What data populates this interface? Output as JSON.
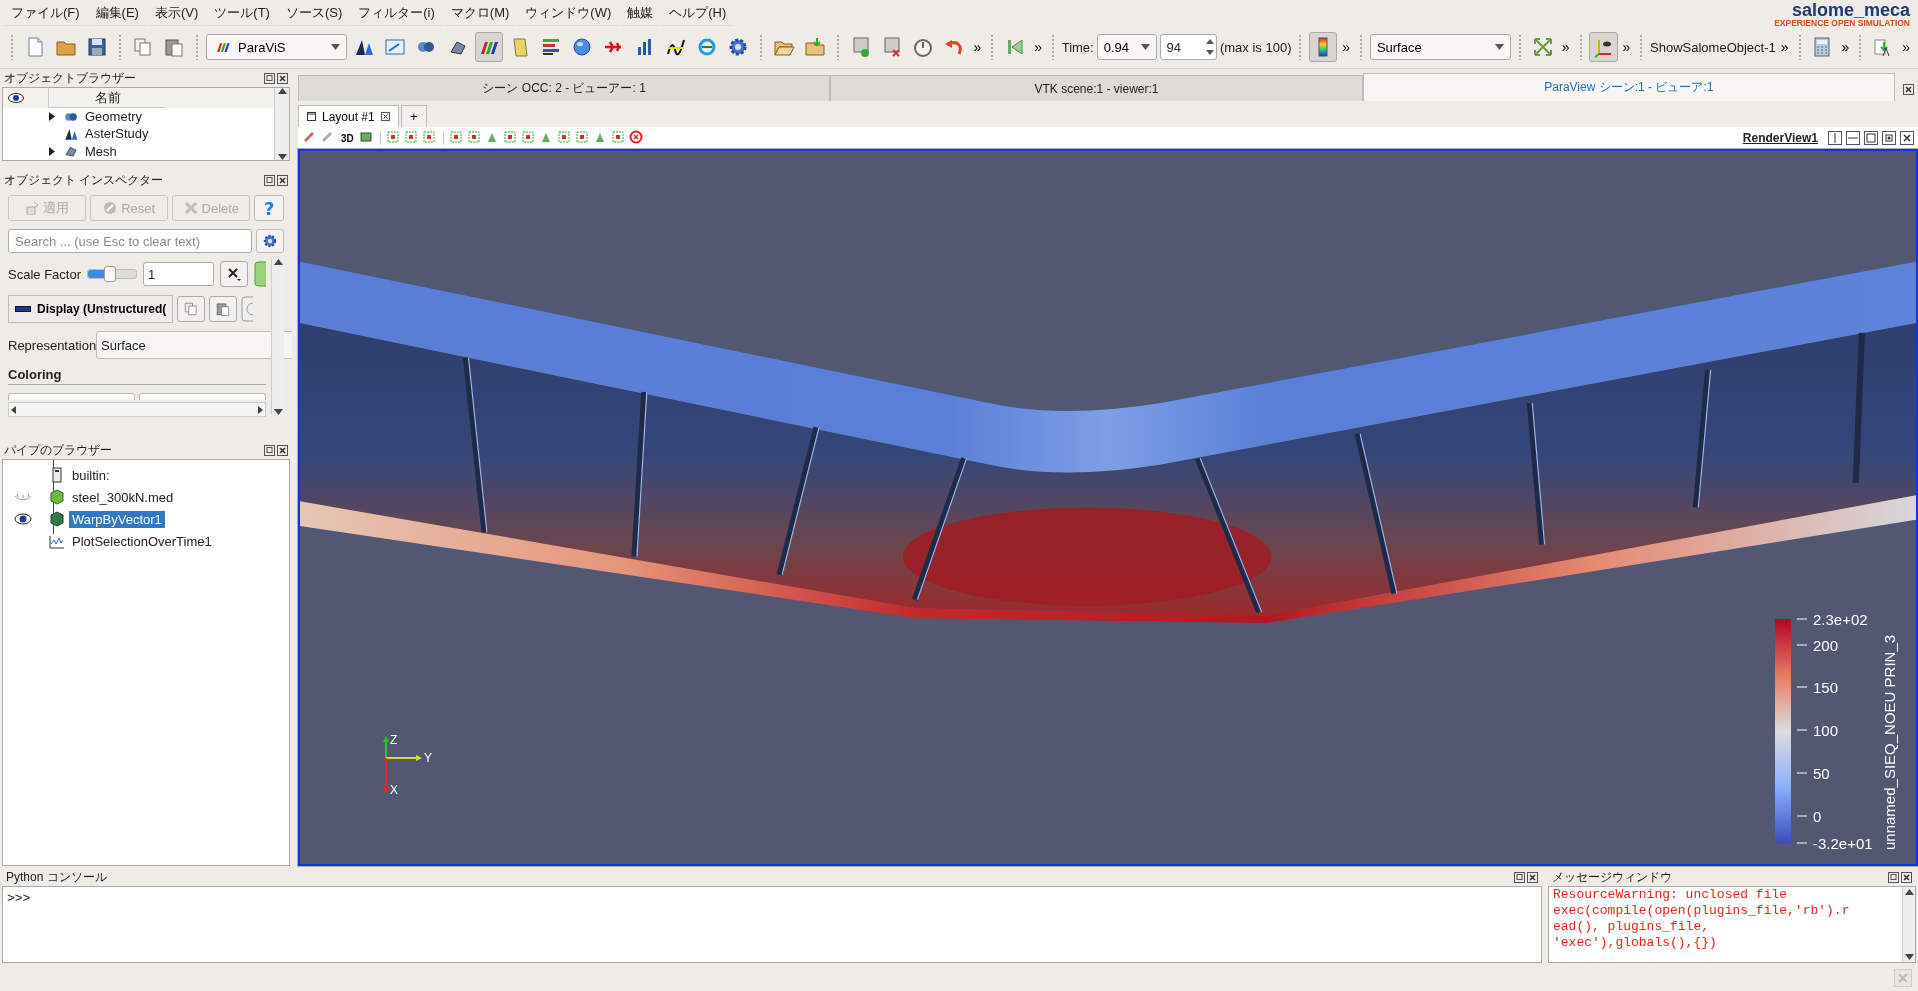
{
  "menu": [
    {
      "label": "ファイル(F)"
    },
    {
      "label": "編集(E)"
    },
    {
      "label": "表示(V)"
    },
    {
      "label": "ツール(T)"
    },
    {
      "label": "ソース(S)"
    },
    {
      "label": "フィルター(i)"
    },
    {
      "label": "マクロ(M)"
    },
    {
      "label": "ウィンドウ(W)"
    },
    {
      "label": "触媒"
    },
    {
      "label": "ヘルプ(H)"
    }
  ],
  "logo": {
    "name": "salome_meca",
    "tagline": "EXPERIENCE OPEN SIMULATION"
  },
  "toolbar": [
    {
      "kind": "sep"
    },
    {
      "kind": "icon",
      "pressed": false
    },
    {
      "kind": "icon",
      "pressed": false
    },
    {
      "kind": "icon",
      "pressed": false
    },
    {
      "kind": "sep"
    },
    {
      "kind": "icon",
      "pressed": false
    },
    {
      "kind": "icon",
      "pressed": false
    },
    {
      "kind": "sep"
    },
    {
      "kind": "combo",
      "value": "ParaViS",
      "icon": true
    },
    {
      "kind": "icon",
      "pressed": false
    },
    {
      "kind": "icon",
      "pressed": false
    },
    {
      "kind": "icon",
      "pressed": false
    },
    {
      "kind": "icon",
      "pressed": false
    },
    {
      "kind": "icon",
      "pressed": true
    },
    {
      "kind": "icon",
      "pressed": false
    },
    {
      "kind": "icon",
      "pressed": false
    },
    {
      "kind": "icon",
      "pressed": false
    },
    {
      "kind": "icon",
      "pressed": false
    },
    {
      "kind": "icon",
      "pressed": false
    },
    {
      "kind": "icon",
      "pressed": false
    },
    {
      "kind": "icon",
      "pressed": false
    },
    {
      "kind": "icon",
      "pressed": false
    },
    {
      "kind": "sep"
    },
    {
      "kind": "icon",
      "pressed": false
    },
    {
      "kind": "icon",
      "pressed": false
    },
    {
      "kind": "sep"
    },
    {
      "kind": "icon",
      "pressed": false
    },
    {
      "kind": "icon",
      "pressed": false
    },
    {
      "kind": "icon",
      "pressed": false
    },
    {
      "kind": "icon",
      "pressed": false
    },
    {
      "kind": "chevron",
      "label": "»"
    },
    {
      "kind": "sep"
    },
    {
      "kind": "icon",
      "pressed": false
    },
    {
      "kind": "chevron",
      "label": "»"
    },
    {
      "kind": "sep"
    },
    {
      "kind": "label",
      "label": "Time:"
    },
    {
      "kind": "combo",
      "value": "0.94"
    },
    {
      "kind": "spin",
      "value": "94"
    },
    {
      "kind": "label",
      "label": "(max is 100)"
    },
    {
      "kind": "sep"
    },
    {
      "kind": "icon",
      "pressed": true
    },
    {
      "kind": "chevron",
      "label": "»"
    },
    {
      "kind": "sep"
    },
    {
      "kind": "combo",
      "value": "Surface"
    },
    {
      "kind": "sep"
    },
    {
      "kind": "icon",
      "pressed": false
    },
    {
      "kind": "chevron",
      "label": "»"
    },
    {
      "kind": "sep"
    },
    {
      "kind": "icon",
      "pressed": true
    },
    {
      "kind": "chevron",
      "label": "»"
    },
    {
      "kind": "sep"
    },
    {
      "kind": "label",
      "label": "ShowSalomeObject-1"
    },
    {
      "kind": "chevron",
      "label": "»"
    },
    {
      "kind": "sep"
    },
    {
      "kind": "icon",
      "pressed": false
    },
    {
      "kind": "chevron",
      "label": "»"
    },
    {
      "kind": "sep"
    },
    {
      "kind": "icon",
      "pressed": false
    },
    {
      "kind": "chevron",
      "label": "»"
    }
  ],
  "object_browser": {
    "title": "オブジェクトブラウザー",
    "column": "名前",
    "items": [
      {
        "label": "Geometry",
        "kind": "branch",
        "expanded": false
      },
      {
        "label": "AsterStudy",
        "kind": "leaf"
      },
      {
        "label": "Mesh",
        "kind": "branch",
        "expanded": false
      }
    ]
  },
  "inspector": {
    "title": "オブジェクト インスペクター",
    "buttons": [
      {
        "label": "適用",
        "disabled": true
      },
      {
        "label": "Reset",
        "disabled": true
      },
      {
        "label": "Delete",
        "disabled": true
      }
    ],
    "help": "?",
    "search": {
      "placeholder": "Search ... (use Esc to clear text)"
    },
    "scale_factor": {
      "label": "Scale Factor",
      "level": 0.45,
      "value": "1"
    },
    "display": "Display (Unstructured(",
    "representation": {
      "label": "Representation",
      "value": "Surface"
    },
    "section": "Coloring"
  },
  "pipeline_browser": {
    "title": "パイプのブラウザー",
    "items": [
      {
        "label": "builtin:",
        "kind": "server",
        "selected": false
      },
      {
        "label": "steel_300kN.med",
        "kind": "source",
        "visible": false,
        "selected": false
      },
      {
        "label": "WarpByVector1",
        "kind": "filter",
        "visible": true,
        "selected": true
      },
      {
        "label": "PlotSelectionOverTime1",
        "kind": "plot",
        "selected": false
      }
    ]
  },
  "viewer_tabs": [
    {
      "label": "シーン OCC: 2 - ビューアー: 1",
      "selected": false
    },
    {
      "label": "VTK scene:1 - viewer:1",
      "selected": false
    },
    {
      "label": "ParaView シーン:1 - ビューア:1",
      "selected": true
    }
  ],
  "layout_tabs": {
    "tabs": [
      {
        "label": "Layout #1",
        "selected": true
      }
    ],
    "add": "+"
  },
  "view_toolbar": {
    "mode": "3D"
  },
  "render_view": {
    "title": "RenderView1",
    "axes": [
      "Z",
      "Y",
      "X"
    ],
    "color_legend": {
      "title": "unnamed_SIEQ_NOEU PRIN_3",
      "labels": [
        "2.3e+02",
        "200",
        "150",
        "100",
        "50",
        "0",
        "-3.2e+01"
      ]
    }
  },
  "python_console": {
    "title": "Python コンソール",
    "prompt": ">>>"
  },
  "message_window": {
    "title": "メッセージウィンドウ",
    "lines": [
      "ResourceWarning: unclosed file",
      "exec(compile(open(plugins_file,'rb').r",
      "ead(), plugins_file,",
      "'exec'),globals(),{})"
    ]
  }
}
